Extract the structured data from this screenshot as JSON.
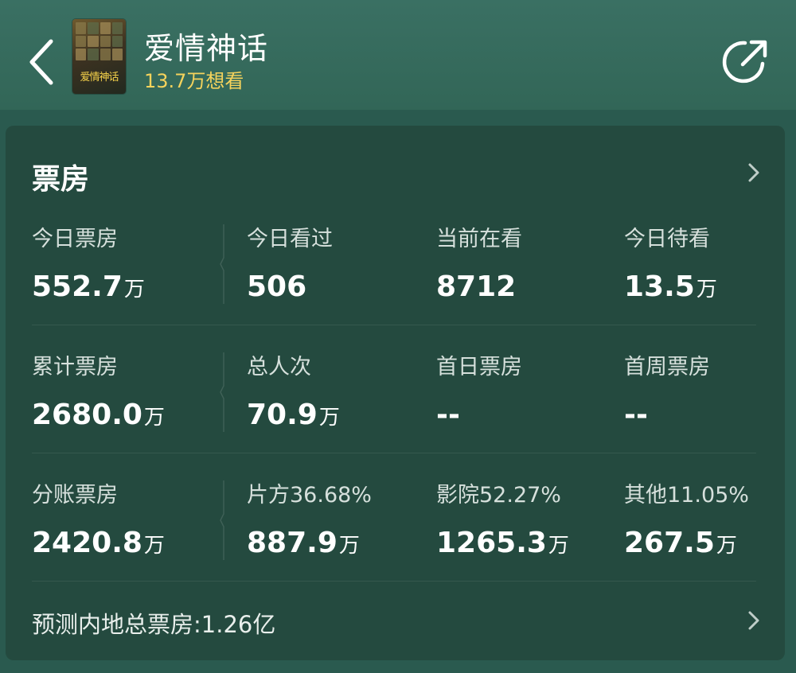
{
  "header": {
    "title": "爱情神话",
    "want_count": "13.7万想看",
    "poster_text": "爱情神话"
  },
  "box_office": {
    "title": "票房",
    "rows": [
      [
        {
          "label": "今日票房",
          "value": "552.7",
          "unit": "万"
        },
        {
          "label": "今日看过",
          "value": "506",
          "unit": ""
        },
        {
          "label": "当前在看",
          "value": "8712",
          "unit": ""
        },
        {
          "label": "今日待看",
          "value": "13.5",
          "unit": "万"
        }
      ],
      [
        {
          "label": "累计票房",
          "value": "2680.0",
          "unit": "万"
        },
        {
          "label": "总人次",
          "value": "70.9",
          "unit": "万"
        },
        {
          "label": "首日票房",
          "value": "--",
          "unit": ""
        },
        {
          "label": "首周票房",
          "value": "--",
          "unit": ""
        }
      ],
      [
        {
          "label": "分账票房",
          "value": "2420.8",
          "unit": "万"
        },
        {
          "label": "片方36.68%",
          "value": "887.9",
          "unit": "万"
        },
        {
          "label": "影院52.27%",
          "value": "1265.3",
          "unit": "万"
        },
        {
          "label": "其他11.05%",
          "value": "267.5",
          "unit": "万"
        }
      ]
    ],
    "forecast": "预测内地总票房:1.26亿"
  },
  "icons": {
    "back": "chevron-left-icon",
    "share": "share-icon",
    "more": "chevron-right-icon"
  },
  "colors": {
    "header_bg": "#326657",
    "page_bg": "#2a5a4f",
    "card_bg": "#244a3f",
    "accent_yellow": "#f5d35c"
  }
}
